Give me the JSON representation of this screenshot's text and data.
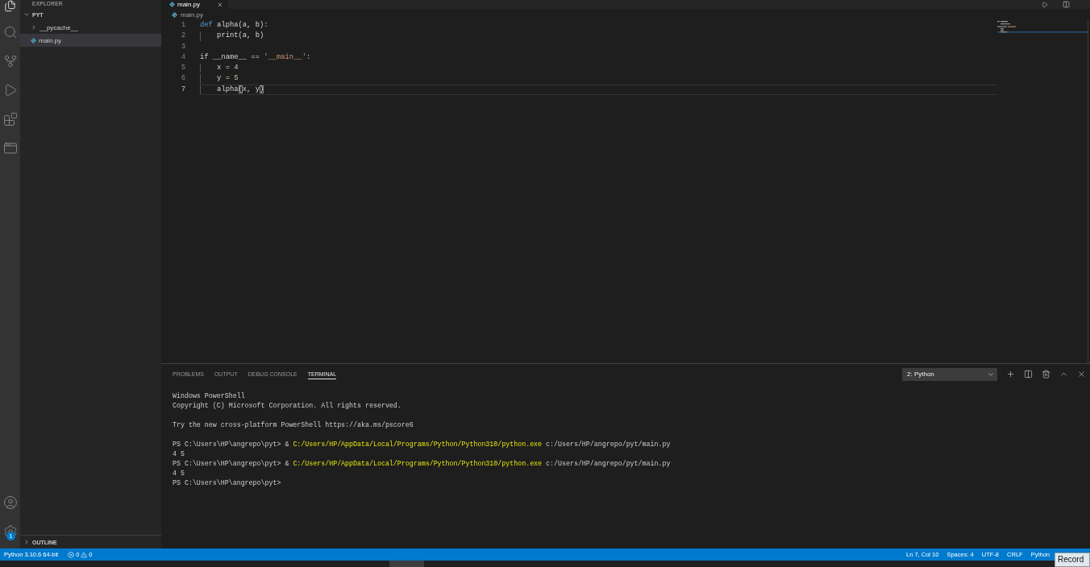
{
  "activity_bar": {
    "items": [
      {
        "kind": "files",
        "selected": true
      },
      {
        "kind": "search",
        "selected": false
      },
      {
        "kind": "branch",
        "selected": false
      },
      {
        "kind": "play",
        "selected": false
      },
      {
        "kind": "blocks",
        "selected": false
      },
      {
        "kind": "window",
        "selected": false
      }
    ],
    "bottom": [
      {
        "kind": "user"
      },
      {
        "kind": "gear",
        "badge": "1"
      }
    ]
  },
  "sidebar": {
    "title": "EXPLORER",
    "tree": [
      {
        "label": "PYT",
        "kind": "root",
        "expanded": true,
        "selected": false,
        "children": [
          {
            "label": "__pycache__",
            "kind": "folder",
            "expanded": false,
            "selected": false
          },
          {
            "label": "main.py",
            "kind": "file",
            "selected": true
          }
        ]
      }
    ],
    "outline": {
      "label": "OUTLINE",
      "expanded": false
    }
  },
  "editor": {
    "tabs": [
      {
        "label": "main.py",
        "selected": true
      }
    ],
    "breadcrumb": "main.py",
    "lines": [
      {
        "number": "1",
        "current": false,
        "indent_guide": false,
        "tokens": [
          {
            "kind": "keyword",
            "text": "def"
          },
          {
            "kind": "plain",
            "text": " alpha(a, b):"
          }
        ]
      },
      {
        "number": "2",
        "current": false,
        "indent_guide": true,
        "tokens": [
          {
            "kind": "plain",
            "text": "    print(a, b)"
          }
        ]
      },
      {
        "number": "3",
        "current": false,
        "indent_guide": false
      },
      {
        "number": "4",
        "current": false,
        "indent_guide": false,
        "tokens": [
          {
            "kind": "plain",
            "text": "if __name__ == "
          },
          {
            "kind": "string",
            "text": "'__main__'"
          },
          {
            "kind": "plain",
            "text": ":"
          }
        ]
      },
      {
        "number": "5",
        "current": false,
        "indent_guide": true,
        "tokens": [
          {
            "kind": "plain",
            "text": "    x = "
          },
          {
            "kind": "number",
            "text": "4"
          }
        ]
      },
      {
        "number": "6",
        "current": false,
        "indent_guide": true,
        "tokens": [
          {
            "kind": "plain",
            "text": "    y = "
          },
          {
            "kind": "number",
            "text": "5"
          }
        ]
      },
      {
        "number": "7",
        "current": true,
        "indent_guide": true,
        "tokens": [
          {
            "kind": "plain",
            "text": "    alpha"
          },
          {
            "kind": "bracket",
            "text": "("
          },
          {
            "kind": "plain",
            "text": "x, y"
          },
          {
            "kind": "bracket",
            "text": ")"
          }
        ]
      }
    ]
  },
  "panel": {
    "tabs": [
      {
        "label": "PROBLEMS",
        "selected": false
      },
      {
        "label": "OUTPUT",
        "selected": false
      },
      {
        "label": "DEBUG CONSOLE",
        "selected": false
      },
      {
        "label": "TERMINAL",
        "selected": true
      }
    ],
    "terminal_select": "2: Python",
    "terminal": {
      "blocks": [
        {
          "lines": [
            {
              "segments": [
                {
                  "kind": "plain",
                  "text": "Windows PowerShell"
                }
              ]
            },
            {
              "segments": [
                {
                  "kind": "plain",
                  "text": "Copyright (C) Microsoft Corporation. All rights reserved."
                }
              ]
            }
          ]
        },
        {
          "lines": [
            {
              "segments": [
                {
                  "kind": "plain",
                  "text": "Try the new cross-platform PowerShell https://aka.ms/pscore6"
                }
              ]
            }
          ]
        },
        {
          "lines": [
            {
              "segments": [
                {
                  "kind": "plain",
                  "text": "PS C:\\Users\\HP\\angrepo\\pyt> & "
                },
                {
                  "kind": "path",
                  "text": "C:/Users/HP/AppData/Local/Programs/Python/Python310/python.exe"
                },
                {
                  "kind": "plain",
                  "text": " c:/Users/HP/angrepo/pyt/main.py"
                }
              ]
            },
            {
              "segments": [
                {
                  "kind": "plain",
                  "text": "4 5"
                }
              ]
            },
            {
              "segments": [
                {
                  "kind": "plain",
                  "text": "PS C:\\Users\\HP\\angrepo\\pyt> & "
                },
                {
                  "kind": "path",
                  "text": "C:/Users/HP/AppData/Local/Programs/Python/Python310/python.exe"
                },
                {
                  "kind": "plain",
                  "text": " c:/Users/HP/angrepo/pyt/main.py"
                }
              ]
            },
            {
              "segments": [
                {
                  "kind": "plain",
                  "text": "4 5"
                }
              ]
            },
            {
              "segments": [
                {
                  "kind": "plain",
                  "text": "PS C:\\Users\\HP\\angrepo\\pyt>"
                }
              ]
            }
          ]
        }
      ]
    }
  },
  "status_bar": {
    "interpreter": "Python 3.10.6 64-bit",
    "errors": "0",
    "warnings": "0",
    "items": [
      "Ln 7, Col 10",
      "Spaces: 4",
      "UTF-8",
      "CRLF",
      "Python"
    ]
  },
  "tooltip": "Record"
}
